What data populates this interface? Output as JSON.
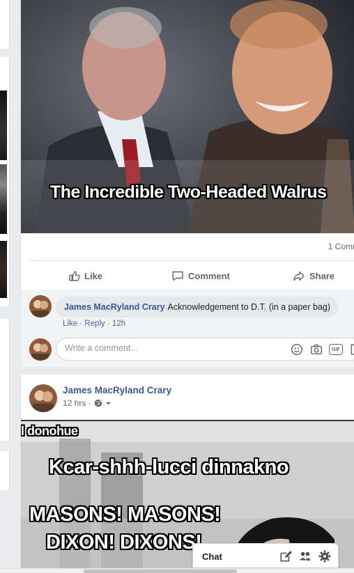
{
  "post1": {
    "meme_caption": "The Incredible Two-Headed Walrus",
    "comment_count": "1 Comm",
    "actions": {
      "like": "Like",
      "comment": "Comment",
      "share": "Share"
    },
    "comment": {
      "author": "James MacRyland Crary",
      "text": "Acknowledgement to D.T. (in a paper bag)",
      "like": "Like",
      "reply": "Reply",
      "sep": "·",
      "time": "12h"
    },
    "write_placeholder": "Write a comment...",
    "gif_label": "GIF"
  },
  "post2": {
    "author": "James MacRyland Crary",
    "time": "12 hrs ·",
    "meme_lines": {
      "top": "l donohue",
      "line1": "Kcar-shhh-lucci dinnakno",
      "line2": "MASONS! MASONS!",
      "line3": "DIXON! DIXONS!"
    }
  },
  "chat": {
    "label": "Chat"
  },
  "colors": {
    "link": "#385898",
    "bg": "#e9ebee",
    "muted": "#606770"
  }
}
